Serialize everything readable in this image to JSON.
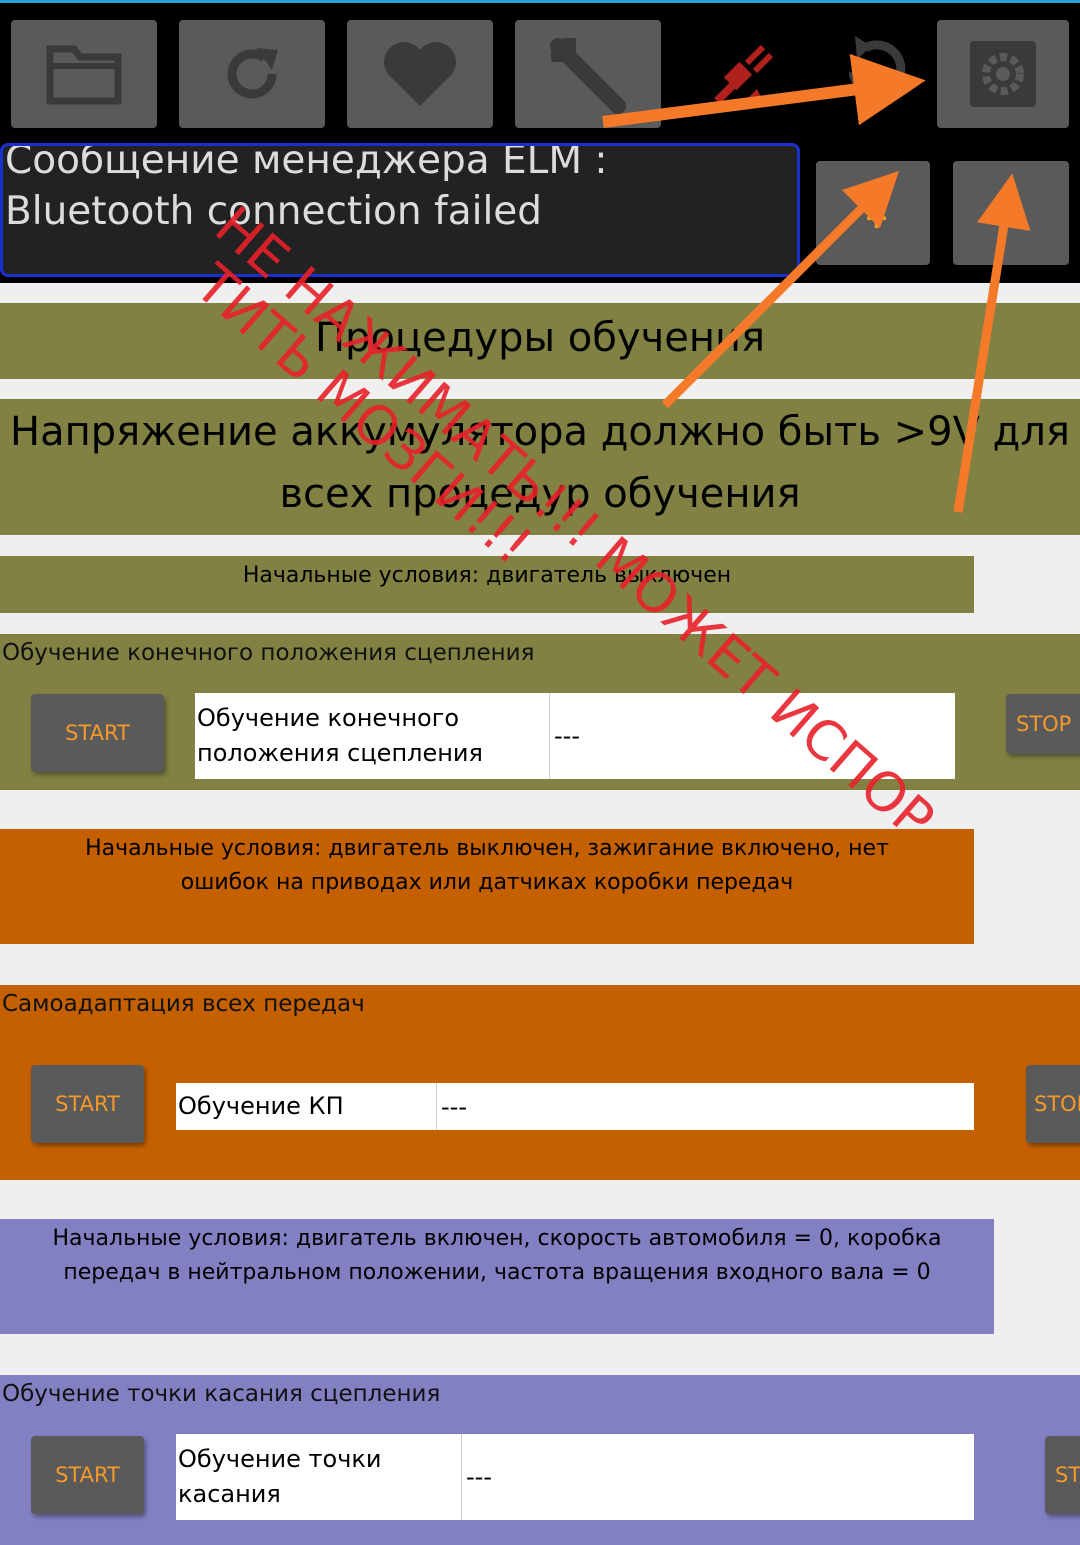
{
  "toolbar": {
    "buttons": [
      {
        "icon": "folder-icon"
      },
      {
        "icon": "refresh-icon"
      },
      {
        "icon": "heart-icon"
      },
      {
        "icon": "wrench-icon"
      },
      {
        "icon": "disconnected-plug-icon"
      },
      {
        "icon": "history-icon"
      },
      {
        "icon": "gear-icon"
      }
    ],
    "message": "Сообщение менеджера ELM : Bluetooth connection failed",
    "plus_label": "+"
  },
  "page": {
    "title": "Процедуры обучения",
    "warning": "Напряжение аккумулятора должно быть >9V для всех процедур обучения"
  },
  "sections": [
    {
      "conditions": "Начальные условия: двигатель выключен",
      "title": "Обучение конечного положения сцепления",
      "start": "START",
      "stop": "STOP",
      "name": "Обучение конечного положения сцепления",
      "value": "---"
    },
    {
      "conditions": "Начальные условия: двигатель выключен, зажигание включено, нет ошибок на приводах или датчиках коробки передач",
      "title": "Самоадаптация всех передач",
      "start": "START",
      "stop": "STOP",
      "name": "Обучение КП",
      "value": "---"
    },
    {
      "conditions": "Начальные условия: двигатель включен, скорость автомобиля = 0, коробка передач в нейтральном положении, частота вращения входного вала = 0",
      "title": "Обучение точки касания сцепления",
      "start": "START",
      "stop": "STOP",
      "name": "Обучение точки касания",
      "value": "---"
    }
  ],
  "annotation": {
    "line1": "НЕ НАЖИМАТЬ!!! МОЖЕТ ИСПОР",
    "line2": "ТИТЬ МОЗГИ!!!",
    "color": "#e8202a",
    "arrow_color": "#f47a2a"
  }
}
